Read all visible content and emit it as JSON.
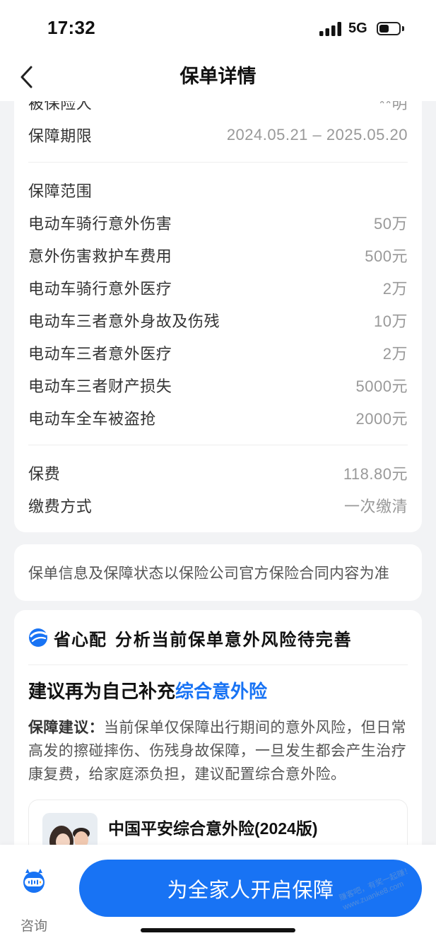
{
  "status_bar": {
    "time": "17:32",
    "network": "5G",
    "battery_level": 0.5,
    "signal_icon": "cellular-signal-icon",
    "battery_icon": "battery-icon"
  },
  "nav": {
    "title": "保单详情",
    "back_icon": "chevron-left-icon"
  },
  "policy": {
    "basic": [
      {
        "label": "被保险人",
        "value": "**明"
      },
      {
        "label": "保障期限",
        "value": "2024.05.21 – 2025.05.20"
      }
    ],
    "coverage_title": "保障范围",
    "coverage": [
      {
        "label": "电动车骑行意外伤害",
        "value": "50万"
      },
      {
        "label": "意外伤害救护车费用",
        "value": "500元"
      },
      {
        "label": "电动车骑行意外医疗",
        "value": "2万"
      },
      {
        "label": "电动车三者意外身故及伤残",
        "value": "10万"
      },
      {
        "label": "电动车三者意外医疗",
        "value": "2万"
      },
      {
        "label": "电动车三者财产损失",
        "value": "5000元"
      },
      {
        "label": "电动车全车被盗抢",
        "value": "2000元"
      }
    ],
    "payment": [
      {
        "label": "保费",
        "value": "118.80元"
      },
      {
        "label": "缴费方式",
        "value": "一次缴清"
      }
    ]
  },
  "disclaimer": "保单信息及保障状态以保险公司官方保险合同内容为准",
  "recommend": {
    "logo_icon": "shengxinpei-logo-icon",
    "brand": "省心配",
    "headline": "分析当前保单意外风险待完善",
    "suggest_prefix": "建议再为自己补充",
    "suggest_highlight": "综合意外险",
    "advice_label": "保障建议：",
    "advice_text": "当前保单仅保障出行期间的意外风险，但日常高发的擦碰摔伤、伤残身故保障，一旦发生都会产生治疗康复费，给家庭添负担，建议配置综合意外险。",
    "product": {
      "name": "中国平安综合意外险(2024版)",
      "image": "family-photo"
    }
  },
  "bottom_bar": {
    "consult_icon": "customer-service-icon",
    "consult_label": "咨询",
    "cta_label": "为全家人开启保障"
  },
  "watermark": {
    "line1": "赚客吧，有奖一起赚！",
    "line2": "www.zuanke8.com"
  },
  "colors": {
    "accent": "#1873f4",
    "background": "#f2f3f5",
    "label": "#333333",
    "value": "#999999"
  }
}
